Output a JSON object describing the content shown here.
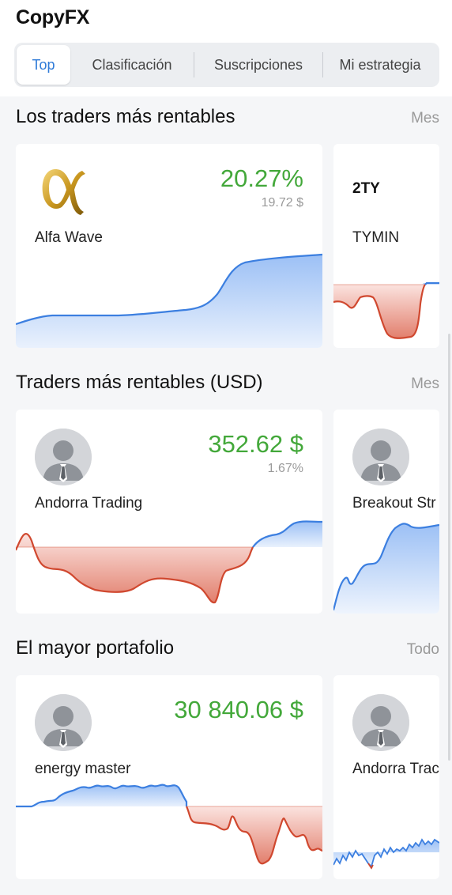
{
  "app": {
    "title": "CopyFX"
  },
  "tabs": [
    {
      "label": "Top",
      "active": true
    },
    {
      "label": "Clasificación",
      "active": false
    },
    {
      "label": "Suscripciones",
      "active": false
    },
    {
      "label": "Mi estrategia",
      "active": false
    }
  ],
  "colors": {
    "accent": "#2f7bd8",
    "positive": "#43a83a",
    "chart_up": "#3c7fe0",
    "chart_down": "#d0482f"
  },
  "sections": [
    {
      "title": "Los traders más rentables",
      "period": "Mes",
      "cards": [
        {
          "name": "Alfa Wave",
          "value": "20.27%",
          "sub_value": "19.72 $",
          "logo": "alfa-wave-logo"
        },
        {
          "name": "TYMIN",
          "logo_text": "2TY",
          "logo": "tymin-logo"
        }
      ]
    },
    {
      "title": "Traders más rentables (USD)",
      "period": "Mes",
      "cards": [
        {
          "name": "Andorra Trading",
          "value": "352.62 $",
          "sub_value": "1.67%",
          "logo": "user-avatar-icon"
        },
        {
          "name": "Breakout Str",
          "logo": "user-avatar-icon"
        }
      ]
    },
    {
      "title": "El mayor portafolio",
      "period": "Todo",
      "cards": [
        {
          "name": "energy master",
          "value": "30 840.06 $",
          "logo": "user-avatar-icon"
        },
        {
          "name": "Andorra Trac",
          "logo": "user-avatar-icon"
        }
      ]
    }
  ]
}
